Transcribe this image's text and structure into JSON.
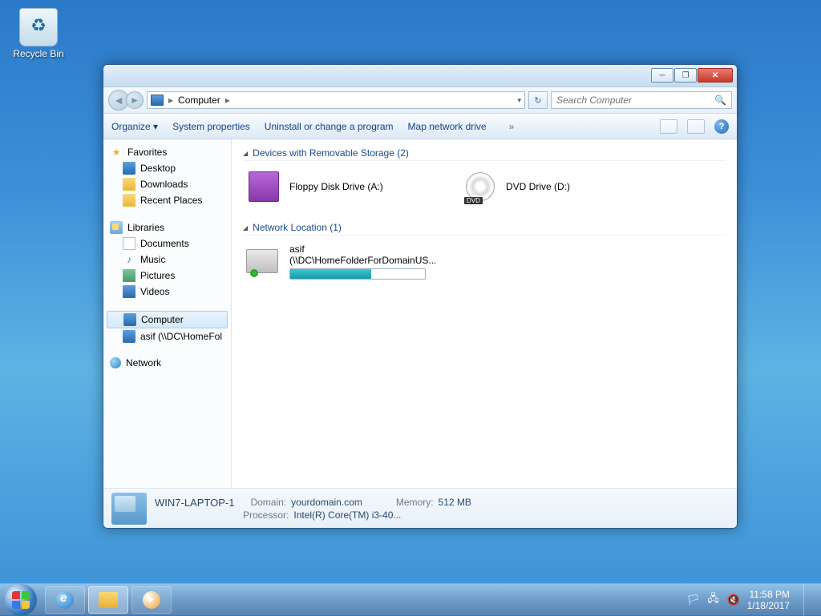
{
  "desktop": {
    "recycle_bin": "Recycle Bin"
  },
  "window": {
    "address": {
      "location": "Computer"
    },
    "search": {
      "placeholder": "Search Computer"
    },
    "toolbar": {
      "organize": "Organize",
      "system_properties": "System properties",
      "uninstall": "Uninstall or change a program",
      "map_drive": "Map network drive"
    },
    "sidebar": {
      "favorites": {
        "label": "Favorites",
        "desktop": "Desktop",
        "downloads": "Downloads",
        "recent": "Recent Places"
      },
      "libraries": {
        "label": "Libraries",
        "documents": "Documents",
        "music": "Music",
        "pictures": "Pictures",
        "videos": "Videos"
      },
      "computer": {
        "label": "Computer",
        "drive": "asif (\\\\DC\\HomeFol"
      },
      "network": {
        "label": "Network"
      }
    },
    "content": {
      "sec1": {
        "title": "Devices with Removable Storage (2)",
        "floppy": "Floppy Disk Drive (A:)",
        "dvd": "DVD Drive (D:)"
      },
      "sec2": {
        "title": "Network Location (1)",
        "name": "asif",
        "path": "(\\\\DC\\HomeFolderForDomainUS..."
      }
    },
    "details": {
      "name": "WIN7-LAPTOP-1",
      "domain_l": "Domain:",
      "domain_v": "yourdomain.com",
      "proc_l": "Processor:",
      "proc_v": "Intel(R) Core(TM) i3-40...",
      "mem_l": "Memory:",
      "mem_v": "512 MB"
    }
  },
  "taskbar": {
    "time": "11:58 PM",
    "date": "1/18/2017"
  }
}
